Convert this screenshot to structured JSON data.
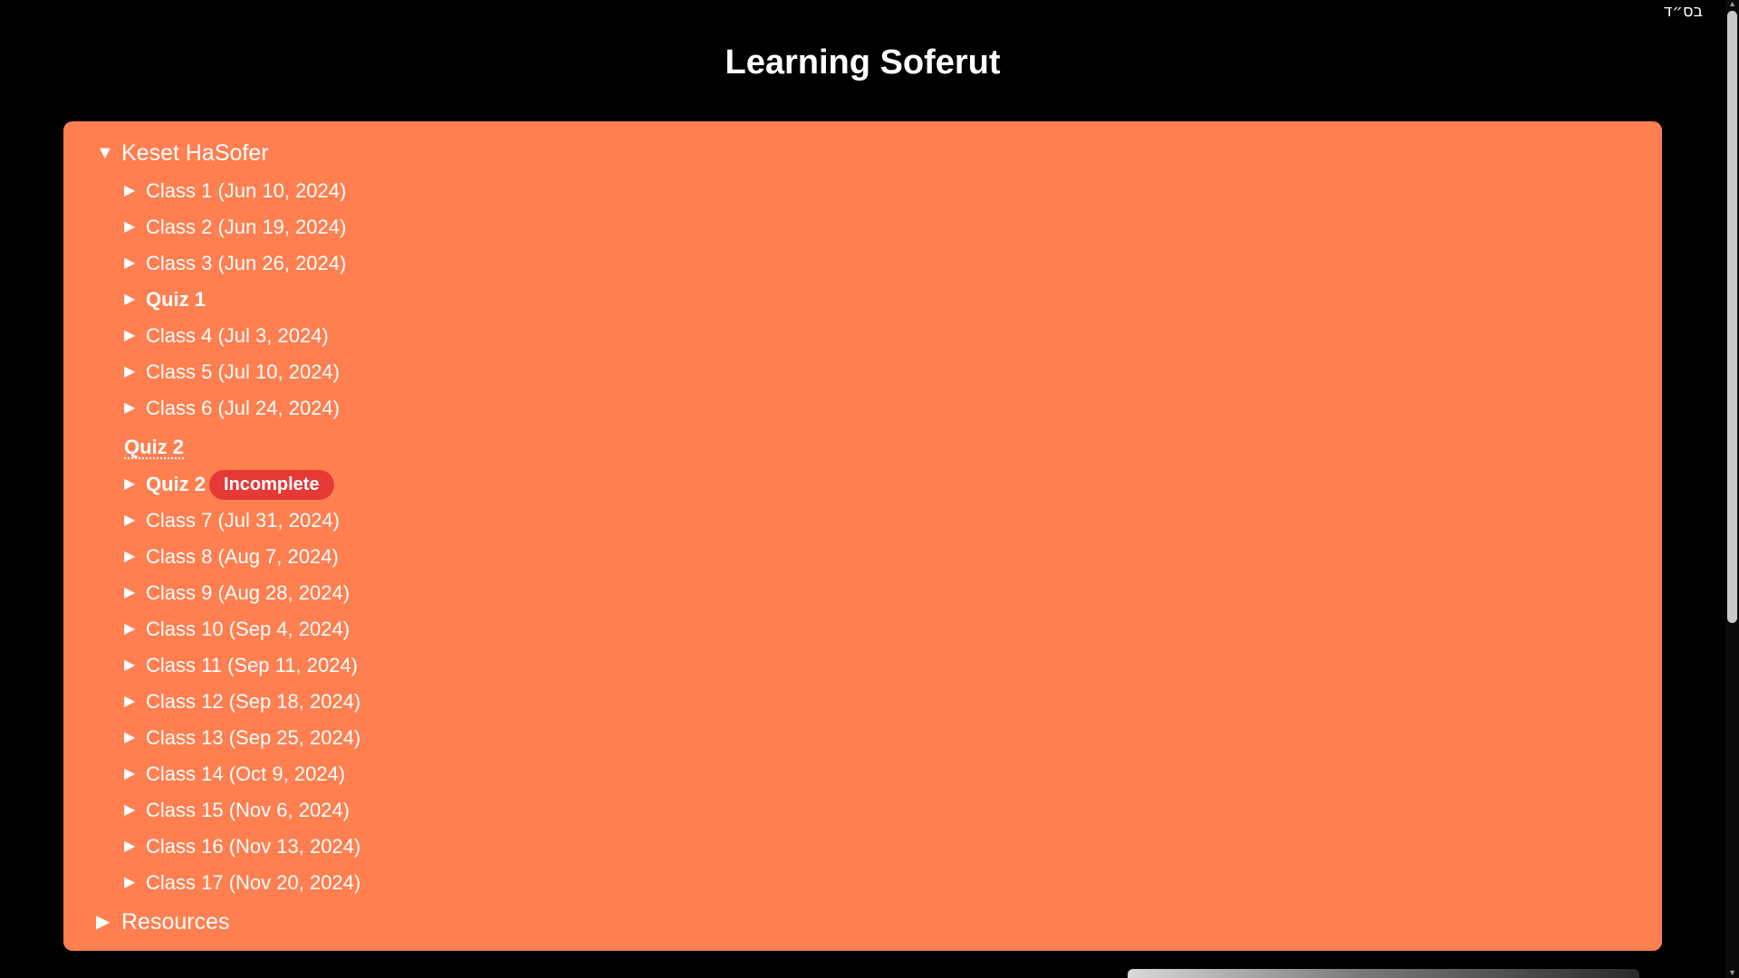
{
  "corner_mark": "בס״ד",
  "title": "Learning Soferut",
  "course": {
    "label": "Keset HaSofer",
    "items": [
      {
        "label": "Class 1 (Jun 10, 2024)"
      },
      {
        "label": "Class 2 (Jun 19, 2024)"
      },
      {
        "label": "Class 3 (Jun 26, 2024)"
      },
      {
        "label": "Quiz 1"
      },
      {
        "label": "Class 4 (Jul 3, 2024)"
      },
      {
        "label": "Class 5 (Jul 10, 2024)"
      },
      {
        "label": "Class 6 (Jul 24, 2024)"
      },
      {
        "label": "Quiz 2"
      },
      {
        "label": "Quiz 2",
        "badge": "Incomplete"
      },
      {
        "label": "Class 7 (Jul 31, 2024)"
      },
      {
        "label": "Class 8 (Aug 7, 2024)"
      },
      {
        "label": "Class 9 (Aug 28, 2024)"
      },
      {
        "label": "Class 10 (Sep 4, 2024)"
      },
      {
        "label": "Class 11 (Sep 11, 2024)"
      },
      {
        "label": "Class 12 (Sep 18, 2024)"
      },
      {
        "label": "Class 13 (Sep 25, 2024)"
      },
      {
        "label": "Class 14 (Oct 9, 2024)"
      },
      {
        "label": "Class 15 (Nov 6, 2024)"
      },
      {
        "label": "Class 16 (Nov 13, 2024)"
      },
      {
        "label": "Class 17 (Nov 20, 2024)"
      }
    ]
  },
  "resources": {
    "label": "Resources"
  },
  "icons": {
    "expanded": "triangle-down-icon",
    "collapsed": "triangle-right-icon"
  },
  "colors": {
    "background": "#000000",
    "panel": "#ff7f50",
    "text": "#ffffff",
    "badge": "#e53935"
  }
}
